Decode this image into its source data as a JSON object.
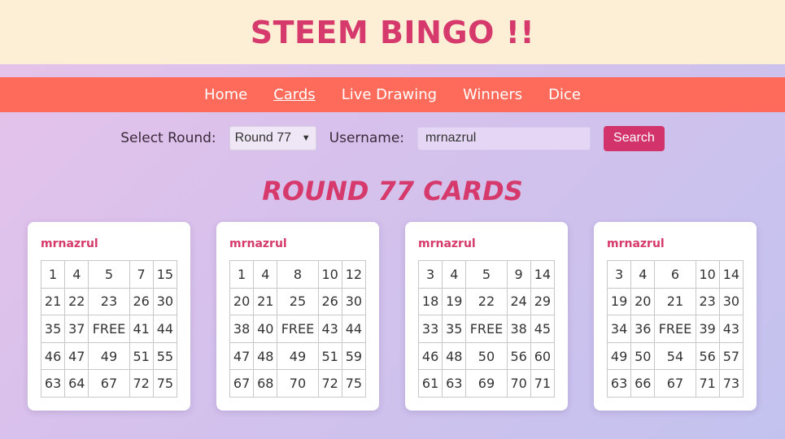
{
  "header": {
    "title": "STEEM BINGO !!"
  },
  "nav": {
    "items": [
      "Home",
      "Cards",
      "Live Drawing",
      "Winners",
      "Dice"
    ]
  },
  "controls": {
    "round_label": "Select Round:",
    "round_value": "Round 77",
    "username_label": "Username:",
    "username_value": "mrnazrul",
    "search_label": "Search"
  },
  "heading": "ROUND 77 CARDS",
  "cards": [
    {
      "user": "mrnazrul",
      "rows": [
        [
          "1",
          "4",
          "5",
          "7",
          "15"
        ],
        [
          "21",
          "22",
          "23",
          "26",
          "30"
        ],
        [
          "35",
          "37",
          "FREE",
          "41",
          "44"
        ],
        [
          "46",
          "47",
          "49",
          "51",
          "55"
        ],
        [
          "63",
          "64",
          "67",
          "72",
          "75"
        ]
      ]
    },
    {
      "user": "mrnazrul",
      "rows": [
        [
          "1",
          "4",
          "8",
          "10",
          "12"
        ],
        [
          "20",
          "21",
          "25",
          "26",
          "30"
        ],
        [
          "38",
          "40",
          "FREE",
          "43",
          "44"
        ],
        [
          "47",
          "48",
          "49",
          "51",
          "59"
        ],
        [
          "67",
          "68",
          "70",
          "72",
          "75"
        ]
      ]
    },
    {
      "user": "mrnazrul",
      "rows": [
        [
          "3",
          "4",
          "5",
          "9",
          "14"
        ],
        [
          "18",
          "19",
          "22",
          "24",
          "29"
        ],
        [
          "33",
          "35",
          "FREE",
          "38",
          "45"
        ],
        [
          "46",
          "48",
          "50",
          "56",
          "60"
        ],
        [
          "61",
          "63",
          "69",
          "70",
          "71"
        ]
      ]
    },
    {
      "user": "mrnazrul",
      "rows": [
        [
          "3",
          "4",
          "6",
          "10",
          "14"
        ],
        [
          "19",
          "20",
          "21",
          "23",
          "30"
        ],
        [
          "34",
          "36",
          "FREE",
          "39",
          "43"
        ],
        [
          "49",
          "50",
          "54",
          "56",
          "57"
        ],
        [
          "63",
          "66",
          "67",
          "71",
          "73"
        ]
      ]
    }
  ]
}
